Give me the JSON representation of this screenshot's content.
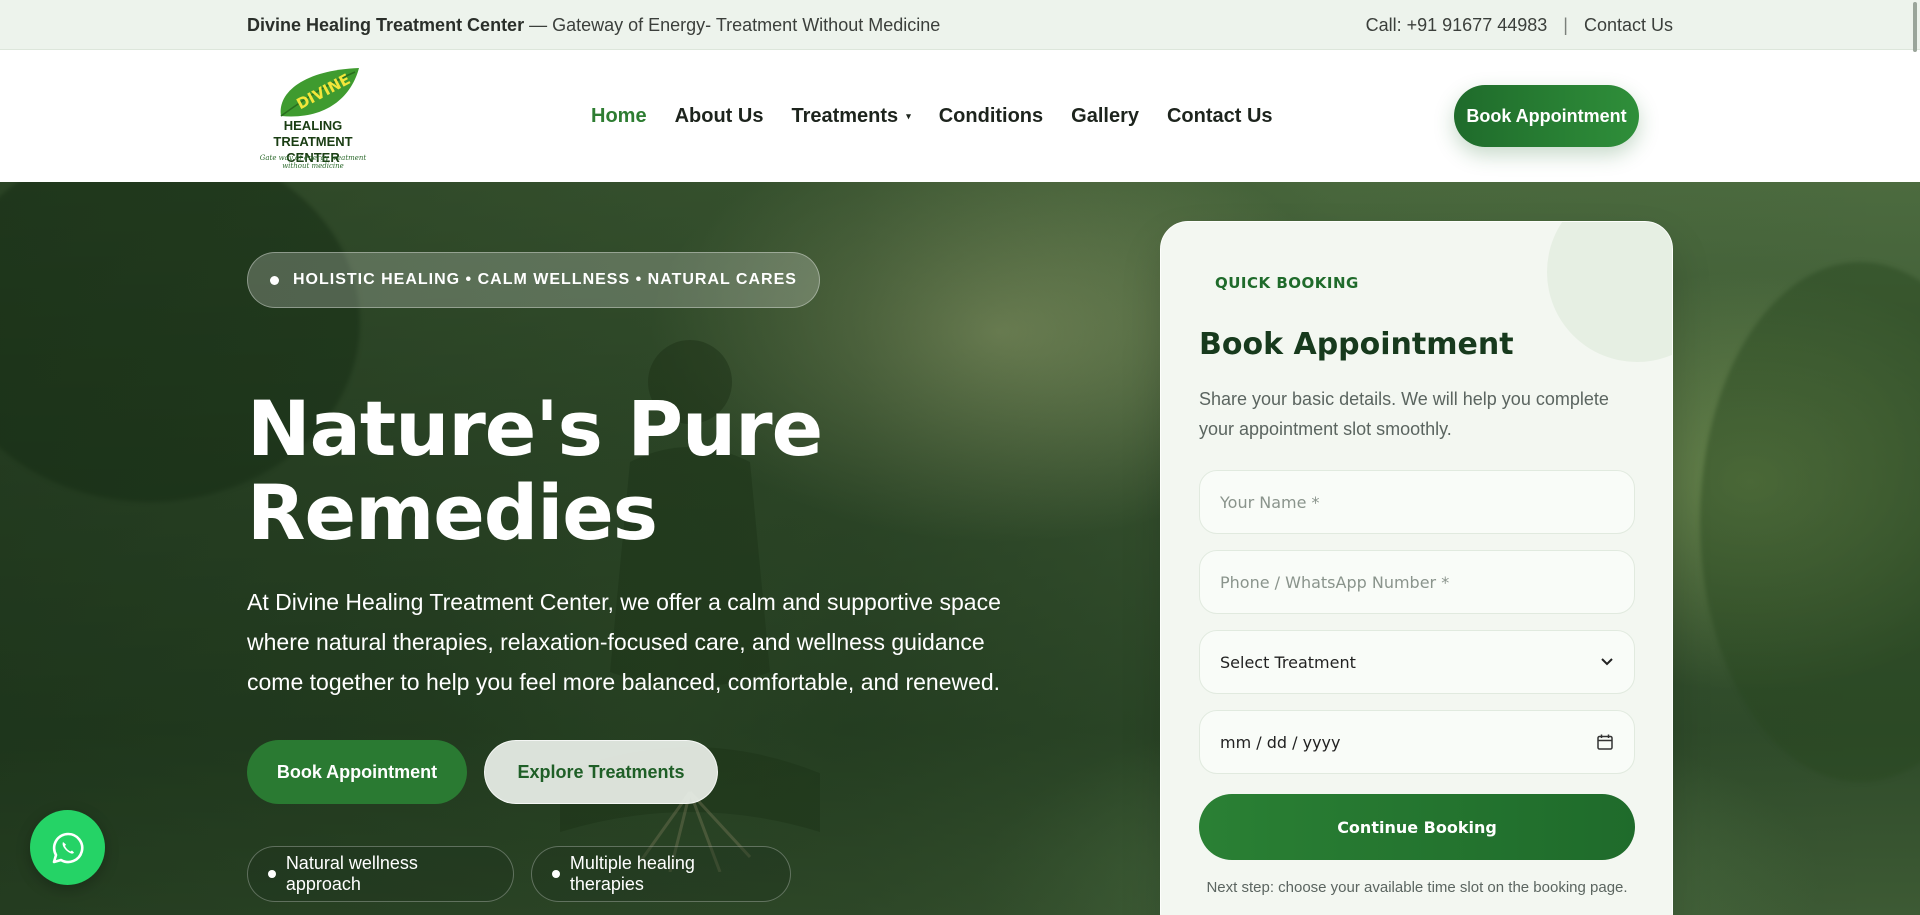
{
  "topbar": {
    "brand": "Divine Healing Treatment Center",
    "tagline": " — Gateway of Energy- Treatment Without Medicine",
    "phone": "Call: +91 91677 44983",
    "separator": "|",
    "contact": "Contact Us"
  },
  "logo": {
    "leaf_text": "DIVINE",
    "line1": "HEALING TREATMENT",
    "line2": "CENTER",
    "tagline": "Gate way of energy treatment without medicine"
  },
  "nav": {
    "items": [
      "Home",
      "About Us",
      "Treatments",
      "Conditions",
      "Gallery",
      "Contact Us"
    ],
    "dropdown_caret": "▾"
  },
  "header": {
    "book_label": "Book Appointment"
  },
  "hero": {
    "pill": "HOLISTIC HEALING • CALM WELLNESS • NATURAL CARES",
    "title_line1": "Nature's Pure",
    "title_line2": "Remedies",
    "description": "At Divine Healing Treatment Center, we offer a calm and supportive space where natural therapies, relaxation-focused care, and wellness guidance come together to help you feel more balanced, comfortable, and renewed.",
    "primary_btn": "Book Appointment",
    "secondary_btn": "Explore Treatments",
    "features": [
      "Natural wellness approach",
      "Multiple healing therapies"
    ]
  },
  "booking": {
    "eyebrow": "QUICK BOOKING",
    "title": "Book Appointment",
    "subtitle": "Share your basic details. We will help you complete your appointment slot smoothly.",
    "name_placeholder": "Your Name *",
    "phone_placeholder": "Phone / WhatsApp Number *",
    "treatment_select": "Select Treatment",
    "date_placeholder": "mm / dd / yyyy",
    "cta": "Continue Booking",
    "note": "Next step: choose your available time slot on the booking page."
  },
  "colors": {
    "brand_green": "#2e7d32",
    "whatsapp": "#25d366"
  },
  "icons": [
    "leaf-logo-icon",
    "caret-down-icon",
    "chevron-down-icon",
    "calendar-icon",
    "whatsapp-icon"
  ]
}
